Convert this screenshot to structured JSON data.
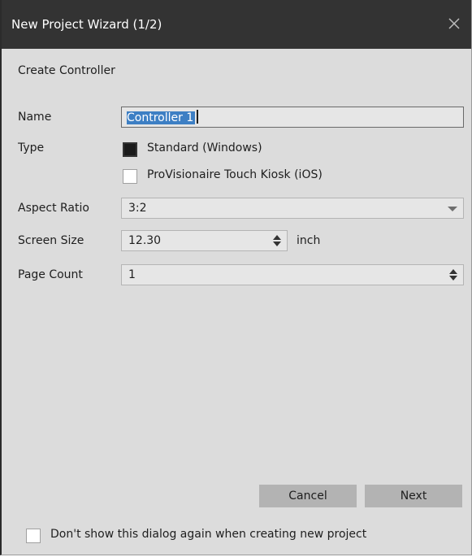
{
  "window": {
    "title": "New Project Wizard (1/2)",
    "close_icon": "close-icon"
  },
  "heading": "Create Controller",
  "form": {
    "name": {
      "label": "Name",
      "value": "Controller 1"
    },
    "type": {
      "label": "Type",
      "options": [
        {
          "label": "Standard (Windows)",
          "checked": true
        },
        {
          "label": "ProVisionaire Touch Kiosk (iOS)",
          "checked": false
        }
      ]
    },
    "aspect_ratio": {
      "label": "Aspect Ratio",
      "value": "3:2"
    },
    "screen_size": {
      "label": "Screen Size",
      "value": "12.30",
      "unit": "inch"
    },
    "page_count": {
      "label": "Page Count",
      "value": "1"
    }
  },
  "buttons": {
    "cancel": "Cancel",
    "next": "Next"
  },
  "footer": {
    "dont_show_label": "Don't show this dialog again when creating new project",
    "checked": false
  },
  "colors": {
    "titlebar": "#333333",
    "dialog_bg": "#dcdcdc",
    "selection": "#3d7fc4",
    "button": "#b3b3b3"
  }
}
